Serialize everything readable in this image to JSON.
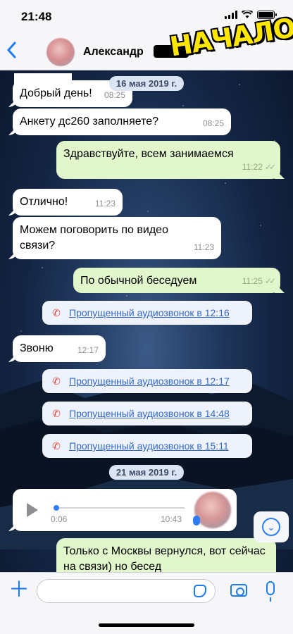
{
  "status_bar": {
    "time": "21:48"
  },
  "header": {
    "back_icon": "chevron-left-icon",
    "contact_name": "Александр"
  },
  "sticker": {
    "text": "НАЧАЛО",
    "color": "#ffe600"
  },
  "messages": [
    {
      "dir": "in",
      "text": "Добрый день!",
      "time": "08:25"
    },
    {
      "dir": "in",
      "text": "Анкету дс260 заполняете?",
      "time": "08:25"
    },
    {
      "dir": "out",
      "text": "Здравствуйте, всем занимаемся",
      "time": "11:22"
    },
    {
      "dir": "in",
      "text": "Отлично!",
      "time": "11:23"
    },
    {
      "dir": "in",
      "text": "Можем поговорить по видео связи?",
      "time": "11:23"
    },
    {
      "dir": "out",
      "text": "По обычной беседуем",
      "time": "11:25"
    },
    {
      "dir": "in",
      "text": "Звоню",
      "time": "12:17"
    },
    {
      "dir": "out",
      "text": "Только с Москвы вернулся, вот сейчас на связи) но бесед"
    }
  ],
  "dates": [
    "16 мая 2019 г.",
    "21 мая 2019 г."
  ],
  "calls": [
    "Пропущенный аудиозвонок в 12:16",
    "Пропущенный аудиозвонок в 12:17",
    "Пропущенный аудиозвонок в 14:48",
    "Пропущенный аудиозвонок в 15:11"
  ],
  "voice_message": {
    "elapsed": "0:06",
    "duration": "10:43",
    "progress": 0.0
  },
  "colors": {
    "accent": "#1e7cf2",
    "outgoing_bubble": "#e1f7cb",
    "incoming_bubble": "#ffffff",
    "missed_call": "#e0443e"
  }
}
